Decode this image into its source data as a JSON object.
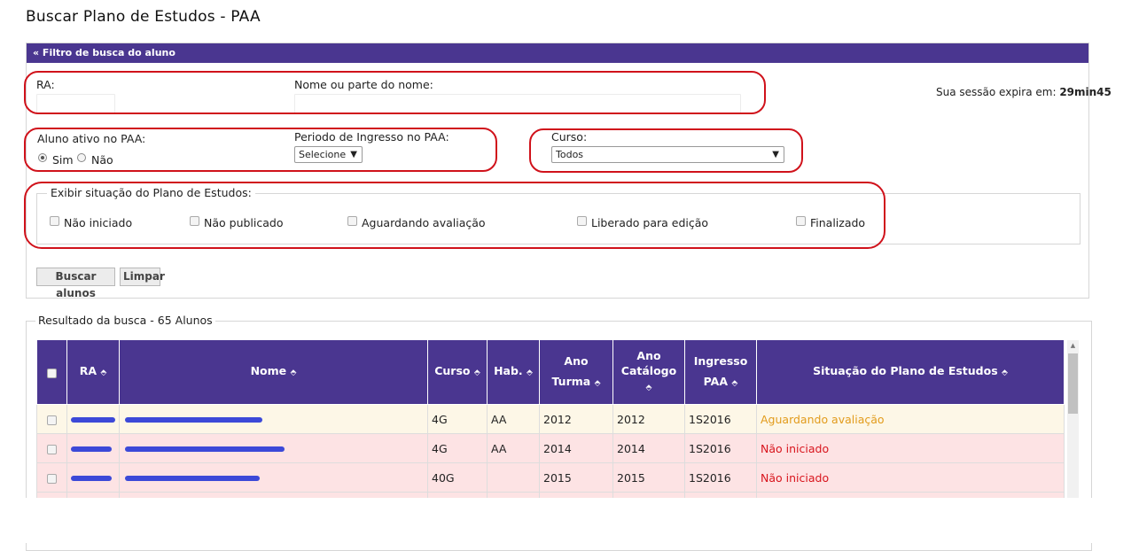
{
  "page": {
    "title": "Buscar Plano de Estudos - PAA"
  },
  "filter": {
    "header": "«  Filtro de busca do aluno",
    "ra_label": "RA:",
    "ra_value": "",
    "name_label": "Nome ou parte do nome:",
    "name_value": "",
    "ativo_label": "Aluno ativo no PAA:",
    "ativo_sim": "Sim",
    "ativo_nao": "Não",
    "ativo_selected": "Sim",
    "periodo_label": "Periodo de Ingresso no PAA:",
    "periodo_value": "Selecione",
    "curso_label": "Curso:",
    "curso_value": "Todos",
    "situacao_legend": "Exibir situação do Plano de Estudos:",
    "situacao_options": [
      "Não iniciado",
      "Não publicado",
      "Aguardando avaliação",
      "Liberado para edição",
      "Finalizado"
    ],
    "buscar_label": "Buscar alunos",
    "limpar_label": "Limpar"
  },
  "session": {
    "label": "Sua sessão expira em:",
    "time": "29min45"
  },
  "results": {
    "legend": "Resultado da busca - 65 Alunos",
    "headers": {
      "ra": "RA",
      "nome": "Nome",
      "curso": "Curso",
      "hab": "Hab.",
      "ano_turma_1": "Ano",
      "ano_turma_2": "Turma",
      "ano_catalogo_1": "Ano",
      "ano_catalogo_2": "Catálogo",
      "ingresso_1": "Ingresso",
      "ingresso_2": "PAA",
      "situacao": "Situação do Plano de Estudos"
    },
    "sort_glyph": "⬘",
    "rows": [
      {
        "curso": "4G",
        "hab": "AA",
        "ano_turma": "2012",
        "ano_catalogo": "2012",
        "ingresso": "1S2016",
        "situacao": "Aguardando avaliação",
        "status": "wait"
      },
      {
        "curso": "4G",
        "hab": "AA",
        "ano_turma": "2014",
        "ano_catalogo": "2014",
        "ingresso": "1S2016",
        "situacao": "Não iniciado",
        "status": "not"
      },
      {
        "curso": "40G",
        "hab": "",
        "ano_turma": "2015",
        "ano_catalogo": "2015",
        "ingresso": "1S2016",
        "situacao": "Não iniciado",
        "status": "not"
      }
    ]
  },
  "colors": {
    "header_purple": "#4a3690",
    "annotation_red": "#d0121b",
    "redaction_blue": "#3c49d8",
    "status_wait": "#e29b1b",
    "status_not": "#d8151d"
  }
}
